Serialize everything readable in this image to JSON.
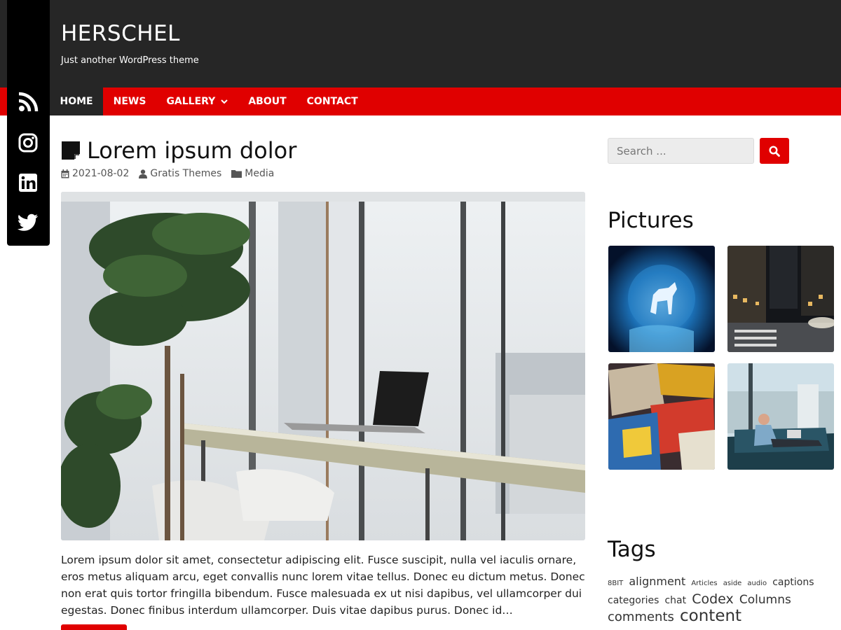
{
  "site": {
    "title": "HERSCHEL",
    "tagline": "Just another WordPress theme"
  },
  "nav": {
    "items": [
      {
        "label": "HOME",
        "active": true
      },
      {
        "label": "NEWS"
      },
      {
        "label": "GALLERY",
        "has_submenu": true
      },
      {
        "label": "ABOUT"
      },
      {
        "label": "CONTACT"
      }
    ]
  },
  "social": [
    "rss-icon",
    "instagram-icon",
    "linkedin-icon",
    "twitter-icon"
  ],
  "post": {
    "title": "Lorem ipsum dolor",
    "date": "2021-08-02",
    "author": "Gratis Themes",
    "category": "Media",
    "excerpt": "Lorem ipsum dolor sit amet, consectetur adipiscing elit. Fusce suscipit, nulla vel iaculis ornare, eros metus aliquam arcu, eget convallis nunc lorem vitae tellus. Donec eu dictum metus. Donec non erat quis tortor fringilla bibendum. Fusce malesuada ex ut nisi dapibus, vel ullamcorper dui egestas. Donec finibus interdum ullamcorper. Duis vitae dapibus purus. Donec id…"
  },
  "sidebar": {
    "search_placeholder": "Search ...",
    "pictures_title": "Pictures",
    "tags_title": "Tags",
    "tags": [
      {
        "label": "8BIT",
        "size": 10
      },
      {
        "label": "alignment",
        "size": 16
      },
      {
        "label": "Articles",
        "size": 10
      },
      {
        "label": "aside",
        "size": 10
      },
      {
        "label": "audio",
        "size": 10
      },
      {
        "label": "captions",
        "size": 14
      },
      {
        "label": "categories",
        "size": 14
      },
      {
        "label": "chat",
        "size": 14
      },
      {
        "label": "Codex",
        "size": 19
      },
      {
        "label": "Columns",
        "size": 17
      },
      {
        "label": "comments",
        "size": 18
      },
      {
        "label": "content",
        "size": 23
      }
    ]
  },
  "colors": {
    "accent": "#e00000",
    "header_bg": "#262626",
    "social_bg": "#000000"
  }
}
